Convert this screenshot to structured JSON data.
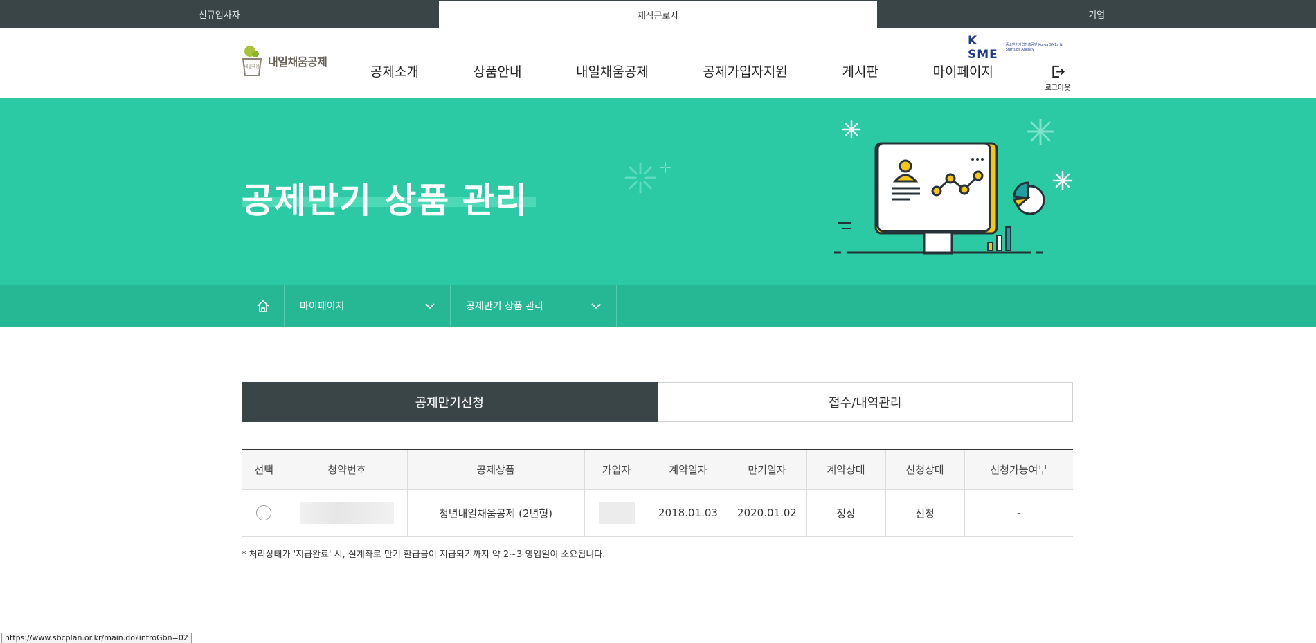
{
  "audience_tabs": [
    {
      "label": "신규입사자"
    },
    {
      "label": "재직근로자"
    },
    {
      "label": "기업"
    }
  ],
  "header": {
    "logo_text": "내일채움공제",
    "logo_mark_text": "내일채움",
    "kosme_text": "K SME",
    "kosme_sub": "중소벤처기업진흥공단 Korea SMEs & Startups Agency",
    "logout_label": "로그아웃",
    "nav": [
      {
        "label": "공제소개"
      },
      {
        "label": "상품안내"
      },
      {
        "label": "내일채움공제"
      },
      {
        "label": "공제가입자지원"
      },
      {
        "label": "게시판"
      },
      {
        "label": "마이페이지"
      }
    ]
  },
  "hero": {
    "title": "공제만기 상품 관리",
    "background_color": "#2cc9a5"
  },
  "breadcrumb": {
    "level1": "마이페이지",
    "level2": "공제만기 상품 관리"
  },
  "tabs": [
    {
      "label": "공제만기신청",
      "active": true
    },
    {
      "label": "접수/내역관리",
      "active": false
    }
  ],
  "table": {
    "headers": [
      "선택",
      "청약번호",
      "공제상품",
      "가입자",
      "계약일자",
      "만기일자",
      "계약상태",
      "신청상태",
      "신청가능여부"
    ],
    "rows": [
      {
        "product": "청년내일채움공제 (2년형)",
        "contract_date": "2018.01.03",
        "maturity_date": "2020.01.02",
        "contract_status": "정상",
        "request_status": "신청",
        "eligible": "-"
      }
    ]
  },
  "note": "* 처리상태가 '지급완료' 시, 실계좌로 만기 환급금이 지급되기까지 약 2~3 영업일이 소요됩니다.",
  "status_bar_url": "https://www.sbcplan.or.kr/main.do?introGbn=02"
}
